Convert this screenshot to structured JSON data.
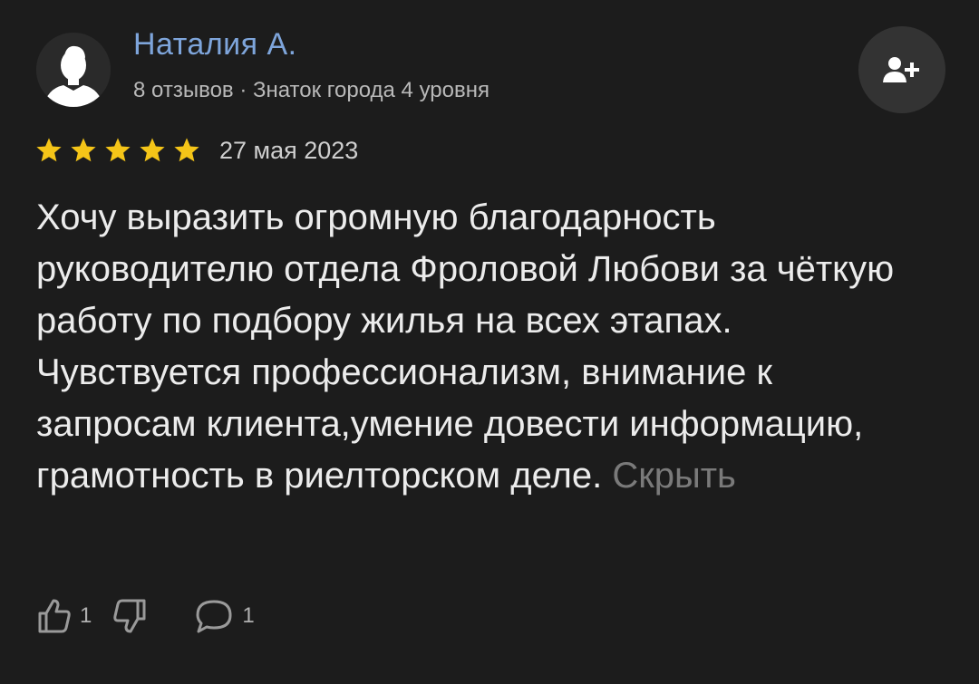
{
  "author": {
    "name": "Наталия А.",
    "meta": "8 отзывов · Знаток города 4 уровня"
  },
  "subscribe": {
    "icon": "add-user-icon"
  },
  "rating": {
    "stars": 5,
    "max": 5,
    "star_color": "#f5c518",
    "date": "27 мая 2023"
  },
  "review": {
    "text": "Хочу выразить огромную благодарность руководителю отдела Фроловой Любови за чёткую работу по подбору жилья на всех этапах. Чувствуется профессионализм, внимание к запросам клиента,умение довести информацию, грамотность в риелторском деле.",
    "collapse_label": "Скрыть"
  },
  "actions": {
    "likes": "1",
    "comments": "1"
  },
  "colors": {
    "background": "#1c1c1c",
    "author_name": "#7ea5db",
    "muted": "#7a7a7a"
  }
}
